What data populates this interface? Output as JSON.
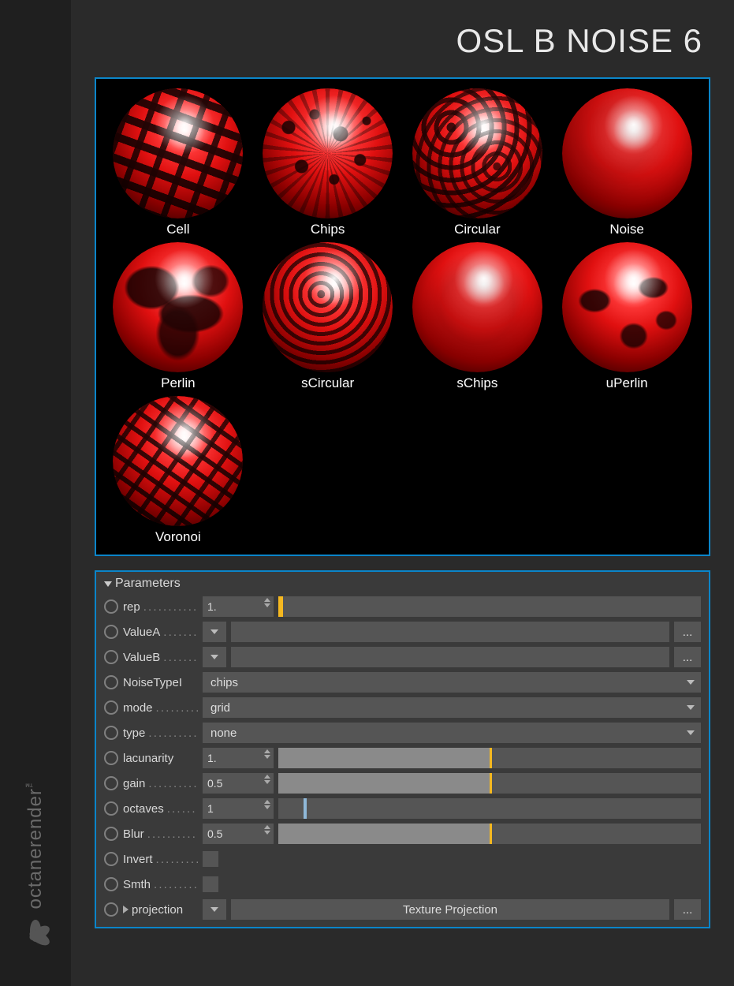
{
  "brand": "octanerender",
  "title": "OSL B NOISE 6",
  "previews": [
    {
      "label": "Cell",
      "pattern": "pat-cell"
    },
    {
      "label": "Chips",
      "pattern": "pat-chips"
    },
    {
      "label": "Circular",
      "pattern": "pat-circular"
    },
    {
      "label": "Noise",
      "pattern": "pat-noise"
    },
    {
      "label": "Perlin",
      "pattern": "pat-perlin"
    },
    {
      "label": "sCircular",
      "pattern": "pat-scircular"
    },
    {
      "label": "sChips",
      "pattern": "pat-schips"
    },
    {
      "label": "uPerlin",
      "pattern": "pat-uperlin"
    },
    {
      "label": "Voronoi",
      "pattern": "pat-voronoi"
    }
  ],
  "panel": {
    "header": "Parameters",
    "rows": {
      "rep": {
        "label": "rep",
        "value": "1.",
        "slider": {
          "fill": 0,
          "marker": 0,
          "color": "orange"
        }
      },
      "valueA": {
        "label": "ValueA"
      },
      "valueB": {
        "label": "ValueB"
      },
      "noiseType": {
        "label": "NoiseTypeI",
        "value": "chips"
      },
      "mode": {
        "label": "mode",
        "value": "grid"
      },
      "type": {
        "label": "type",
        "value": "none"
      },
      "lacunarity": {
        "label": "lacunarity",
        "value": "1.",
        "slider": {
          "fill": 50,
          "marker": 50,
          "color": "orange"
        }
      },
      "gain": {
        "label": "gain",
        "value": "0.5",
        "slider": {
          "fill": 50,
          "marker": 50,
          "color": "orange"
        }
      },
      "octaves": {
        "label": "octaves",
        "value": "1",
        "slider": {
          "fill": 0,
          "marker": 6,
          "color": "blue"
        }
      },
      "blur": {
        "label": "Blur",
        "value": "0.5",
        "slider": {
          "fill": 50,
          "marker": 50,
          "color": "orange"
        }
      },
      "invert": {
        "label": "Invert",
        "checked": false
      },
      "smth": {
        "label": "Smth",
        "checked": false
      },
      "projection": {
        "label": "projection",
        "value": "Texture Projection"
      }
    }
  }
}
